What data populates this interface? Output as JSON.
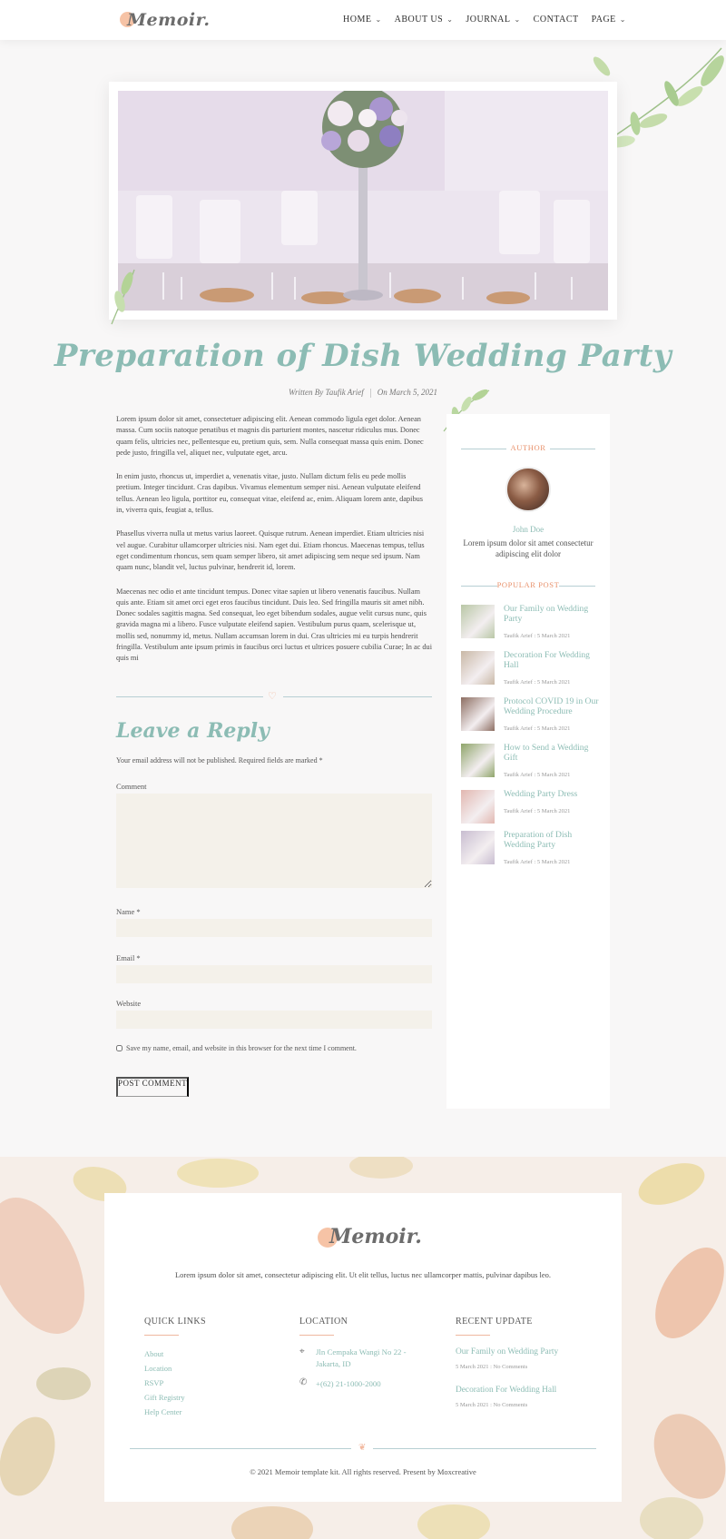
{
  "header": {
    "logo_text": "Memoir.",
    "nav": [
      {
        "label": "HOME",
        "has_dropdown": true
      },
      {
        "label": "ABOUT US",
        "has_dropdown": true
      },
      {
        "label": "JOURNAL",
        "has_dropdown": true
      },
      {
        "label": "CONTACT",
        "has_dropdown": false
      },
      {
        "label": "PAGE",
        "has_dropdown": true
      }
    ]
  },
  "post": {
    "title": "Preparation of Dish Wedding Party",
    "author_line": "Written By Taufik Arief",
    "date_line": "On March 5, 2021",
    "paragraphs": [
      "Lorem ipsum dolor sit amet, consectetuer adipiscing elit. Aenean commodo ligula eget dolor. Aenean massa. Cum sociis natoque penatibus et magnis dis parturient montes, nascetur ridiculus mus. Donec quam felis, ultricies nec, pellentesque eu, pretium quis, sem. Nulla consequat massa quis enim. Donec pede justo, fringilla vel, aliquet nec, vulputate eget, arcu.",
      "In enim justo, rhoncus ut, imperdiet a, venenatis vitae, justo. Nullam dictum felis eu pede mollis pretium. Integer tincidunt. Cras dapibus. Vivamus elementum semper nisi. Aenean vulputate eleifend tellus. Aenean leo ligula, porttitor eu, consequat vitae, eleifend ac, enim. Aliquam lorem ante, dapibus in, viverra quis, feugiat a, tellus.",
      "Phasellus viverra nulla ut metus varius laoreet. Quisque rutrum. Aenean imperdiet. Etiam ultricies nisi vel augue. Curabitur ullamcorper ultricies nisi. Nam eget dui. Etiam rhoncus. Maecenas tempus, tellus eget condimentum rhoncus, sem quam semper libero, sit amet adipiscing sem neque sed ipsum. Nam quam nunc, blandit vel, luctus pulvinar, hendrerit id, lorem.",
      "Maecenas nec odio et ante tincidunt tempus. Donec vitae sapien ut libero venenatis faucibus. Nullam quis ante. Etiam sit amet orci eget eros faucibus tincidunt. Duis leo. Sed fringilla mauris sit amet nibh. Donec sodales sagittis magna. Sed consequat, leo eget bibendum sodales, augue velit cursus nunc, quis gravida magna mi a libero. Fusce vulputate eleifend sapien. Vestibulum purus quam, scelerisque ut, mollis sed, nonummy id, metus. Nullam accumsan lorem in dui. Cras ultricies mi eu turpis hendrerit fringilla. Vestibulum ante ipsum primis in faucibus orci luctus et ultrices posuere cubilia Curae; In ac dui quis mi"
    ]
  },
  "reply": {
    "title": "Leave a Reply",
    "note": "Your email address will not be published. Required fields are marked *",
    "comment_label": "Comment",
    "name_label": "Name *",
    "email_label": "Email *",
    "website_label": "Website",
    "comment_value": "",
    "name_value": "",
    "email_value": "",
    "website_value": "",
    "save_info_label": "Save my name, email, and website in this browser for the next time I comment.",
    "save_info_checked": false,
    "submit_label": "POST COMMENT"
  },
  "sidebar": {
    "author_heading": "AUTHOR",
    "author_name": "John Doe",
    "author_desc": "Lorem ipsum dolor sit amet consectetur adipiscing elit dolor",
    "popular_heading": "POPULAR POST",
    "popular_posts": [
      {
        "title": "Our Family on Wedding Party",
        "meta": "Taufik Arief : 5 March 2021",
        "thumb_color": "#b9c7a6"
      },
      {
        "title": "Decoration For Wedding Hall",
        "meta": "Taufik Arief : 5 March 2021",
        "thumb_color": "#c9b8a6"
      },
      {
        "title": "Protocol COVID 19 in Our Wedding Procedure",
        "meta": "Taufik Arief : 5 March 2021",
        "thumb_color": "#8d6e62"
      },
      {
        "title": "How to Send a Wedding Gift",
        "meta": "Taufik Arief : 5 March 2021",
        "thumb_color": "#8fa56a"
      },
      {
        "title": "Wedding Party Dress",
        "meta": "Taufik Arief : 5 March 2021",
        "thumb_color": "#e2b7b0"
      },
      {
        "title": "Preparation of Dish Wedding Party",
        "meta": "Taufik Arief : 5 March 2021",
        "thumb_color": "#c8bdd0"
      }
    ]
  },
  "footer": {
    "logo_text": "Memoir.",
    "description": "Lorem ipsum dolor sit amet, consectetur adipiscing elit. Ut elit tellus, luctus nec ullamcorper mattis, pulvinar dapibus leo.",
    "quick_links_title": "QUICK LINKS",
    "quick_links": [
      "About",
      "Location",
      "RSVP",
      "Gift Registry",
      "Help Center"
    ],
    "location_title": "LOCATION",
    "address": "Jln Cempaka Wangi No 22 - Jakarta, ID",
    "phone": "+(62) 21-1000-2000",
    "recent_title": "RECENT UPDATE",
    "recent": [
      {
        "title": "Our Family on Wedding Party",
        "meta": "5 March 2021 : No Comments"
      },
      {
        "title": "Decoration For Wedding Hall",
        "meta": "5 March 2021 : No Comments"
      }
    ],
    "copyright": "© 2021 Memoir template kit. All rights reserved. Present by Moxcreative"
  },
  "colors": {
    "accent_teal": "#8cbcb4",
    "accent_peach": "#e8906a",
    "field_bg": "#f4f1ea"
  }
}
